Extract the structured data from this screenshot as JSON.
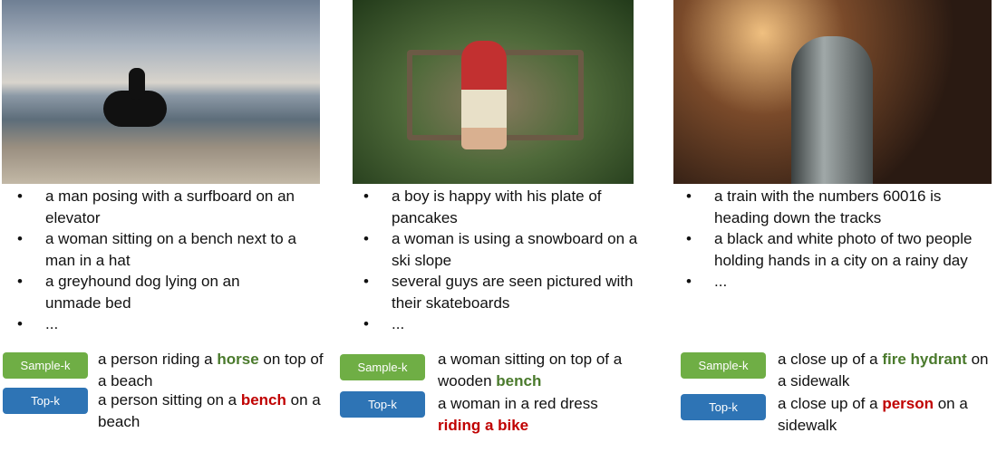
{
  "columns": [
    {
      "captions": [
        "a man posing with a surfboard on an elevator",
        "a woman sitting on a bench next to a man in a hat",
        "a greyhound dog lying on an unmade bed",
        "..."
      ],
      "sample_k": {
        "label": "Sample-k",
        "pre": "a person riding a ",
        "highlight": "horse",
        "post": " on top of a beach"
      },
      "top_k": {
        "label": "Top-k",
        "pre": "a person sitting on a ",
        "highlight": "bench",
        "post": " on a beach"
      }
    },
    {
      "captions": [
        "a boy is happy with his plate of pancakes",
        "a woman is using a snowboard on a ski slope",
        "several guys are seen pictured with their skateboards",
        "..."
      ],
      "sample_k": {
        "label": "Sample-k",
        "pre": "a woman sitting on top of a wooden ",
        "highlight": "bench",
        "post": ""
      },
      "top_k": {
        "label": "Top-k",
        "pre": "a woman in a red dress ",
        "highlight": "riding a bike",
        "post": ""
      }
    },
    {
      "captions": [
        "a train with the numbers 60016 is heading down the tracks",
        "a black and white photo of two people holding hands in a city on a rainy day",
        "..."
      ],
      "sample_k": {
        "label": "Sample-k",
        "pre": "a close up of a ",
        "highlight": "fire hydrant",
        "post": " on a sidewalk"
      },
      "top_k": {
        "label": "Top-k",
        "pre": "a close up of a ",
        "highlight": "person",
        "post": " on a sidewalk"
      }
    }
  ],
  "bullet": "•",
  "colors": {
    "sample_k": "#6fae45",
    "top_k": "#2e74b5",
    "correct": "#4a7a2c",
    "wrong": "#c00000"
  }
}
